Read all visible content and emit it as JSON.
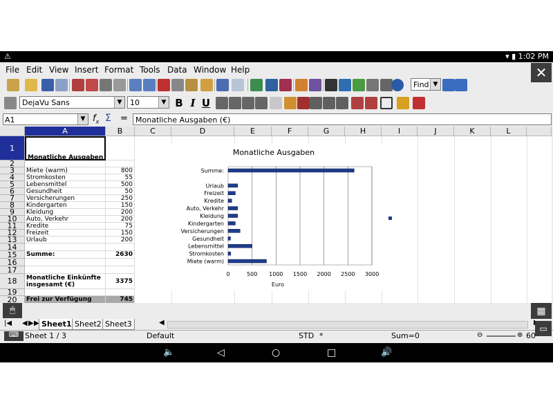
{
  "status_bar": {
    "time": "1:02 PM"
  },
  "menu": [
    "File",
    "Edit",
    "View",
    "Insert",
    "Format",
    "Tools",
    "Data",
    "Window",
    "Help"
  ],
  "toolbar": {
    "find_label": "Find"
  },
  "format": {
    "font_name": "DejaVu Sans",
    "font_size": "10"
  },
  "formula": {
    "cell_ref": "A1",
    "content": "Monatliche Ausgaben (€)"
  },
  "columns": [
    "A",
    "B",
    "C",
    "D",
    "E",
    "F",
    "G",
    "H",
    "I",
    "J",
    "K",
    "L"
  ],
  "rows": [
    {
      "num": "1",
      "label": "Monatliche Ausgaben (€)",
      "value": ""
    },
    {
      "num": "2",
      "label": "",
      "value": ""
    },
    {
      "num": "3",
      "label": "Miete (warm)",
      "value": "800"
    },
    {
      "num": "4",
      "label": "Stromkosten",
      "value": "55"
    },
    {
      "num": "5",
      "label": "Lebensmittel",
      "value": "500"
    },
    {
      "num": "6",
      "label": "Gesundheit",
      "value": "50"
    },
    {
      "num": "7",
      "label": "Versicherungen",
      "value": "250"
    },
    {
      "num": "8",
      "label": "Kindergarten",
      "value": "150"
    },
    {
      "num": "9",
      "label": "Kleidung",
      "value": "200"
    },
    {
      "num": "10",
      "label": "Auto, Verkehr",
      "value": "200"
    },
    {
      "num": "11",
      "label": "Kredite",
      "value": "75"
    },
    {
      "num": "12",
      "label": "Freizeit",
      "value": "150"
    },
    {
      "num": "13",
      "label": "Urlaub",
      "value": "200"
    },
    {
      "num": "14",
      "label": "",
      "value": ""
    },
    {
      "num": "15",
      "label": "Summe:",
      "value": "2630"
    },
    {
      "num": "16",
      "label": "",
      "value": ""
    },
    {
      "num": "17",
      "label": "",
      "value": ""
    },
    {
      "num": "18",
      "label": "Monatliche Einkünfte insgesamt (€)",
      "value": "3375"
    },
    {
      "num": "19",
      "label": "",
      "value": ""
    },
    {
      "num": "20",
      "label": "Frei zur Verfügung",
      "value": "745"
    }
  ],
  "sheets": [
    "Sheet1",
    "Sheet2",
    "Sheet3"
  ],
  "status": {
    "page": "Sheet 1 / 3",
    "style": "Default",
    "mode": "STD",
    "modifier": "*",
    "sum": "Sum=0",
    "zoom": "60"
  },
  "chart_data": {
    "type": "bar",
    "orientation": "horizontal",
    "title": "Monatliche Ausgaben",
    "xlabel": "Euro",
    "ylabel": "",
    "categories": [
      "Summe:",
      "",
      "Urlaub",
      "Freizeit",
      "Kredite",
      "Auto, Verkehr",
      "Kleidung",
      "Kindergarten",
      "Versicherungen",
      "Gesundheit",
      "Lebensmittel",
      "Stromkosten",
      "Miete (warm)"
    ],
    "values": [
      2630,
      0,
      200,
      150,
      75,
      200,
      200,
      150,
      250,
      50,
      500,
      55,
      800
    ],
    "xticks": [
      0,
      500,
      1000,
      1500,
      2000,
      2500,
      3000
    ],
    "xlim": [
      0,
      3000
    ],
    "grid": true,
    "bar_color": "#1f3c8c"
  }
}
